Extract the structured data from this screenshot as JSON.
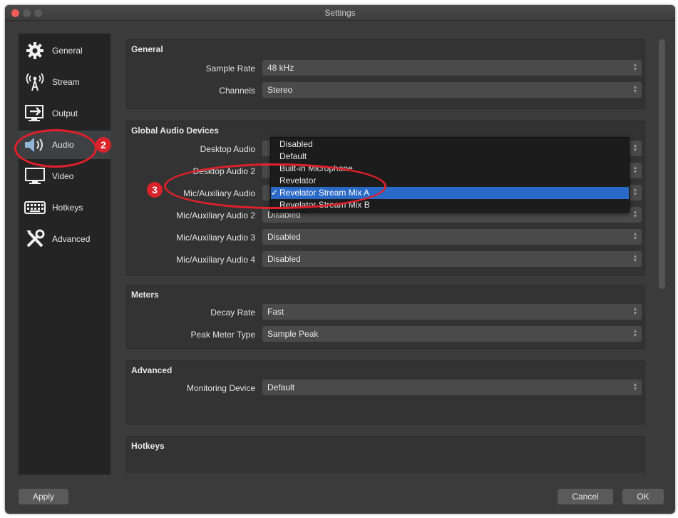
{
  "window": {
    "title": "Settings"
  },
  "sidebar": {
    "items": [
      {
        "label": "General",
        "icon": "gear-icon"
      },
      {
        "label": "Stream",
        "icon": "broadcast-icon"
      },
      {
        "label": "Output",
        "icon": "output-icon"
      },
      {
        "label": "Audio",
        "icon": "speaker-icon",
        "selected": true
      },
      {
        "label": "Video",
        "icon": "monitor-icon"
      },
      {
        "label": "Hotkeys",
        "icon": "keyboard-icon"
      },
      {
        "label": "Advanced",
        "icon": "tools-icon"
      }
    ]
  },
  "general": {
    "title": "General",
    "sample_rate_label": "Sample Rate",
    "sample_rate_value": "48 kHz",
    "channels_label": "Channels",
    "channels_value": "Stereo"
  },
  "devices": {
    "title": "Global Audio Devices",
    "desktop1_label": "Desktop Audio",
    "desktop2_label": "Desktop Audio 2",
    "mic1_label": "Mic/Auxiliary Audio",
    "mic2_label": "Mic/Auxiliary Audio 2",
    "mic2_value": "Disabled",
    "mic3_label": "Mic/Auxiliary Audio 3",
    "mic3_value": "Disabled",
    "mic4_label": "Mic/Auxiliary Audio 4",
    "mic4_value": "Disabled"
  },
  "dropdown": {
    "options": [
      "Disabled",
      "Default",
      "Built-in Microphone",
      "Revelator",
      "Revelator Stream Mix A",
      "Revelator Stream Mix B"
    ],
    "selected_index": 4,
    "check": "✓"
  },
  "meters": {
    "title": "Meters",
    "decay_label": "Decay Rate",
    "decay_value": "Fast",
    "peak_label": "Peak Meter Type",
    "peak_value": "Sample Peak"
  },
  "advanced": {
    "title": "Advanced",
    "monitoring_label": "Monitoring Device",
    "monitoring_value": "Default"
  },
  "hotkeys": {
    "title": "Hotkeys"
  },
  "annotations": {
    "badge2": "2",
    "badge3": "3",
    "color": "#e0202a"
  },
  "buttons": {
    "apply": "Apply",
    "cancel": "Cancel",
    "ok": "OK"
  }
}
